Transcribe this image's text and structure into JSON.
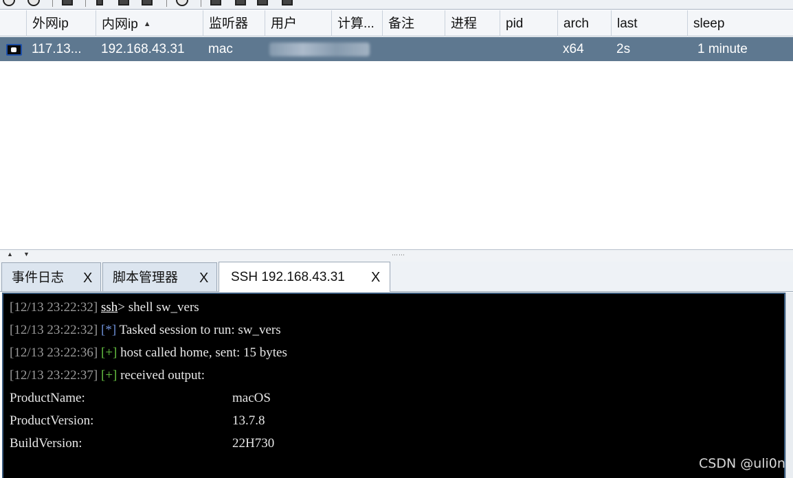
{
  "table": {
    "columns": [
      {
        "label": "外网ip"
      },
      {
        "label": "内网ip",
        "sorted": "asc"
      },
      {
        "label": "监听器"
      },
      {
        "label": "用户"
      },
      {
        "label": "计算..."
      },
      {
        "label": "备注"
      },
      {
        "label": "进程"
      },
      {
        "label": "pid"
      },
      {
        "label": "arch"
      },
      {
        "label": "last"
      },
      {
        "label": "sleep"
      }
    ],
    "rows": [
      {
        "external_ip": "117.13...",
        "internal_ip": "192.168.43.31",
        "listener": "mac",
        "user": "",
        "computer": "",
        "note": "",
        "process": "",
        "pid": "",
        "arch": "x64",
        "last": "2s",
        "sleep": "1 minute",
        "selected": true
      }
    ]
  },
  "tabs": [
    {
      "label": "事件日志",
      "close": "X",
      "active": false
    },
    {
      "label": "脚本管理器",
      "close": "X",
      "active": false
    },
    {
      "label": "SSH 192.168.43.31",
      "close": "X",
      "active": true
    }
  ],
  "console": {
    "lines": [
      {
        "ts": "[12/13 23:22:32]",
        "prompt": "ssh",
        "prompt_suffix": ">",
        "text": " shell sw_vers"
      },
      {
        "ts": "[12/13 23:22:32]",
        "marker": "[*]",
        "text": " Tasked session to run: sw_vers"
      },
      {
        "ts": "[12/13 23:22:36]",
        "marker": "[+]",
        "text": " host called home, sent: 15 bytes"
      },
      {
        "ts": "[12/13 23:22:37]",
        "marker": "[+]",
        "text": " received output:"
      }
    ],
    "output": [
      {
        "key": "ProductName:",
        "value": "macOS"
      },
      {
        "key": "ProductVersion:",
        "value": "13.7.8"
      },
      {
        "key": "BuildVersion:",
        "value": "22H730"
      }
    ]
  },
  "watermark": "CSDN @uli0n",
  "colors": {
    "selected_row": "#5e7890",
    "console_bg": "#000000",
    "marker_info": "#6d8fd6",
    "marker_ok": "#66c142",
    "timestamp": "#9a9a9a"
  }
}
